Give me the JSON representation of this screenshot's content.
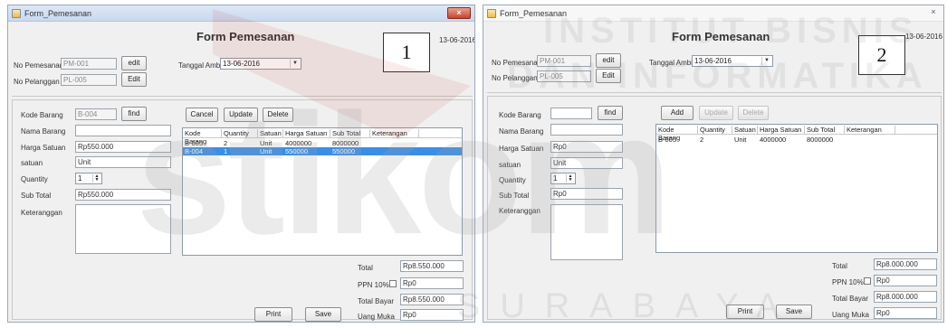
{
  "forms": [
    {
      "window_title": "Form_Pemesanan",
      "close": "×",
      "title": "Form Pemesanan",
      "date": "13-06-2016",
      "label_box": "1",
      "no_pemesanan": {
        "label": "No Pemesanan",
        "value": "PM-001"
      },
      "no_pelanggan": {
        "label": "No Pelanggan",
        "value": "PL-005"
      },
      "edit1": "edit",
      "edit2": "Edit",
      "tanggal_ambil": {
        "label": "Tanggal Ambil",
        "value": "13-06-2016"
      },
      "kode_barang": {
        "label": "Kode Barang",
        "value": "B-004"
      },
      "find": "find",
      "nama_barang": {
        "label": "Nama Barang",
        "value": ""
      },
      "harga_satuan": {
        "label": "Harga Satuan",
        "value": "Rp550.000"
      },
      "satuan": {
        "label": "satuan",
        "value": "Unit"
      },
      "quantity": {
        "label": "Quantity",
        "value": "1"
      },
      "sub_total": {
        "label": "Sub Total",
        "value": "Rp550.000"
      },
      "keterangan": {
        "label": "Keteranggan",
        "value": ""
      },
      "btn_a": "Cancel",
      "btn_b": "Update",
      "btn_c": "Delete",
      "columns": [
        "Kode Barang",
        "Quantity",
        "Satuan",
        "Harga Satuan",
        "Sub Total",
        "Keterangan"
      ],
      "rows": [
        [
          "B-005",
          "2",
          "Unit",
          "4000000",
          "8000000",
          ""
        ],
        [
          "B-004",
          "1",
          "Unit",
          "550000",
          "550000",
          ""
        ]
      ],
      "selected_row": 1,
      "total": {
        "label": "Total",
        "value": "Rp8.550.000"
      },
      "ppn": {
        "label": "PPN 10%",
        "value": "Rp0"
      },
      "total_bayar": {
        "label": "Total Bayar",
        "value": "Rp8.550.000"
      },
      "uang_muka": {
        "label": "Uang Muka",
        "value": "Rp0"
      },
      "print": "Print",
      "save": "Save"
    },
    {
      "window_title": "Form_Pemesanan",
      "close": "×",
      "title": "Form Pemesanan",
      "date": "13-06-2016",
      "label_box": "2",
      "no_pemesanan": {
        "label": "No Pemesanan",
        "value": "PM-001"
      },
      "no_pelanggan": {
        "label": "No Pelanggan",
        "value": "PL-005"
      },
      "edit1": "edit",
      "edit2": "Edit",
      "tanggal_ambil": {
        "label": "Tanggal Ambil",
        "value": "13-06-2016"
      },
      "kode_barang": {
        "label": "Kode Barang",
        "value": ""
      },
      "find": "find",
      "nama_barang": {
        "label": "Nama Barang",
        "value": ""
      },
      "harga_satuan": {
        "label": "Harga Satuan",
        "value": "Rp0"
      },
      "satuan": {
        "label": "satuan",
        "value": "Unit"
      },
      "quantity": {
        "label": "Quantity",
        "value": "1"
      },
      "sub_total": {
        "label": "Sub Total",
        "value": "Rp0"
      },
      "keterangan": {
        "label": "Keteranggan",
        "value": ""
      },
      "btn_a": "Add",
      "btn_b": "Update",
      "btn_c": "Delete",
      "columns": [
        "Kode Barang",
        "Quantity",
        "Satuan",
        "Harga Satuan",
        "Sub Total",
        "Keterangan"
      ],
      "rows": [
        [
          "B-005",
          "2",
          "Unit",
          "4000000",
          "8000000",
          ""
        ]
      ],
      "selected_row": -1,
      "total": {
        "label": "Total",
        "value": "Rp8.000.000"
      },
      "ppn": {
        "label": "PPN 10%",
        "value": "Rp0"
      },
      "total_bayar": {
        "label": "Total Bayar",
        "value": "Rp8.000.000"
      },
      "uang_muka": {
        "label": "Uang Muka",
        "value": "Rp0"
      },
      "print": "Print",
      "save": "Save"
    }
  ],
  "watermark": {
    "line1": "INSTITUT BISNIS",
    "line2": "DAN INFORMATIKA",
    "logo": "stikom",
    "line3": "SURABAYA",
    "logo_color": "#a3a3a3",
    "accent": "#c0392b"
  }
}
